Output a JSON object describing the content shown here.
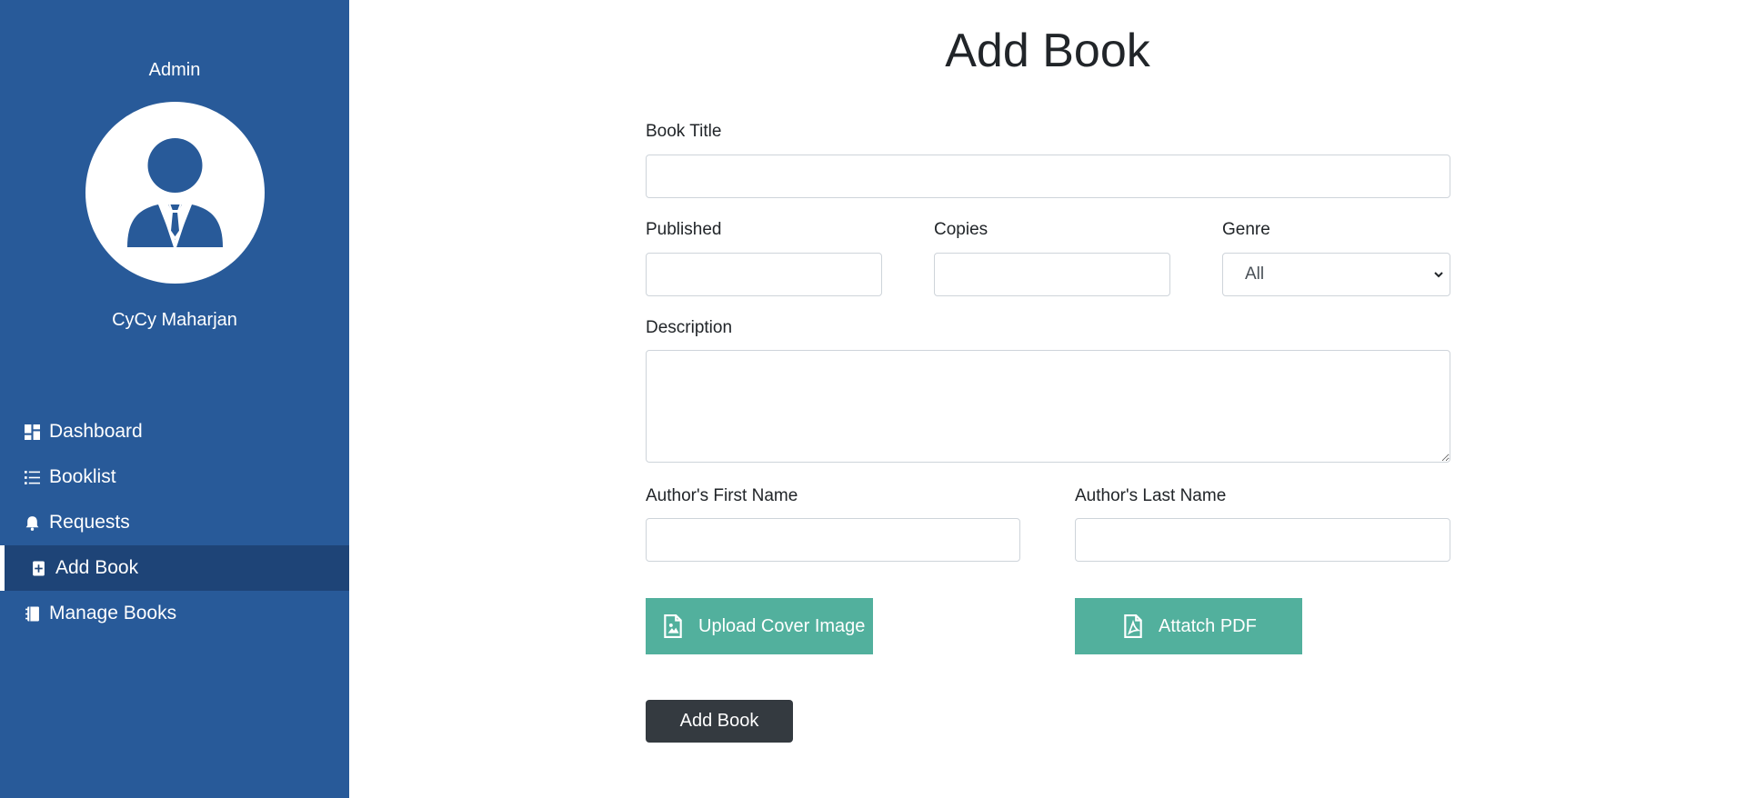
{
  "sidebar": {
    "role": "Admin",
    "user_name": "CyCy Maharjan",
    "items": [
      {
        "label": "Dashboard",
        "icon": "dashboard-icon"
      },
      {
        "label": "Booklist",
        "icon": "list-icon"
      },
      {
        "label": "Requests",
        "icon": "bell-icon"
      },
      {
        "label": "Add Book",
        "icon": "add-book-icon",
        "active": true
      },
      {
        "label": "Manage Books",
        "icon": "books-icon"
      }
    ]
  },
  "form": {
    "title": "Add Book",
    "book_title_label": "Book Title",
    "published_label": "Published",
    "copies_label": "Copies",
    "genre_label": "Genre",
    "genre_selected": "All",
    "description_label": "Description",
    "author_first_label": "Author's First Name",
    "author_last_label": "Author's Last Name",
    "upload_cover_label": "Upload Cover Image",
    "attach_pdf_label": "Attatch PDF",
    "submit_label": "Add Book"
  },
  "colors": {
    "sidebar_bg": "#285a99",
    "sidebar_active": "#1e4477",
    "upload_button": "#52b09d",
    "submit_button": "#343a40"
  }
}
